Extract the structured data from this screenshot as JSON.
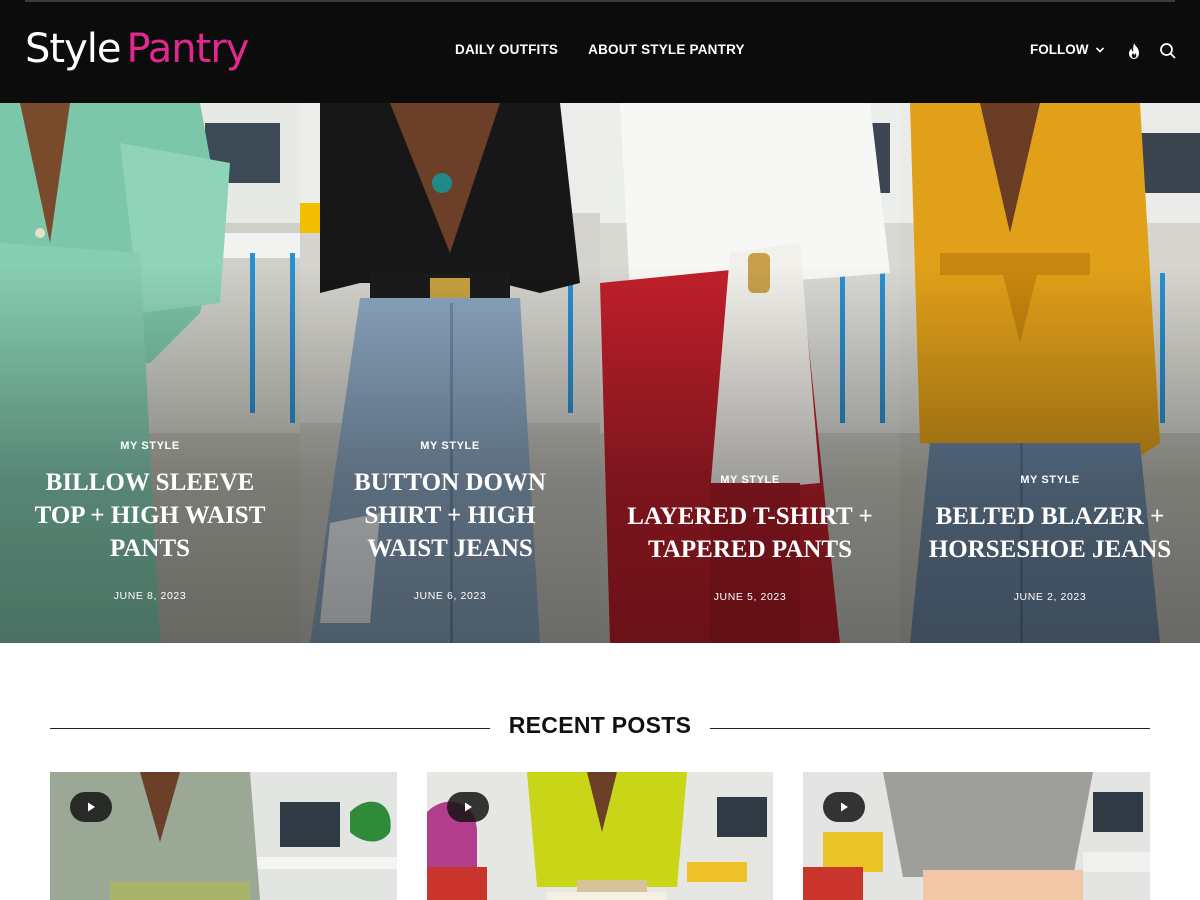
{
  "header": {
    "logo_part1": "Style",
    "logo_part2": "Pantry",
    "nav": [
      "DAILY OUTFITS",
      "ABOUT STYLE PANTRY"
    ],
    "follow_label": "FOLLOW",
    "icons": [
      "chevron-down-icon",
      "flame-icon",
      "search-icon"
    ],
    "logo_color": "#e0288f"
  },
  "hero": [
    {
      "category": "MY STYLE",
      "title": "BILLOW SLEEVE TOP + HIGH WAIST PANTS",
      "date": "JUNE 8, 2023"
    },
    {
      "category": "MY STYLE",
      "title": "BUTTON DOWN SHIRT + HIGH WAIST JEANS",
      "date": "JUNE 6, 2023"
    },
    {
      "category": "MY STYLE",
      "title": "LAYERED T-SHIRT + TAPERED PANTS",
      "date": "JUNE 5, 2023"
    },
    {
      "category": "MY STYLE",
      "title": "BELTED BLAZER + HORSESHOE JEANS",
      "date": "JUNE 2, 2023"
    }
  ],
  "recent": {
    "heading": "RECENT POSTS",
    "cards": [
      {
        "icon": "play-icon"
      },
      {
        "icon": "play-icon"
      },
      {
        "icon": "play-icon"
      }
    ]
  }
}
